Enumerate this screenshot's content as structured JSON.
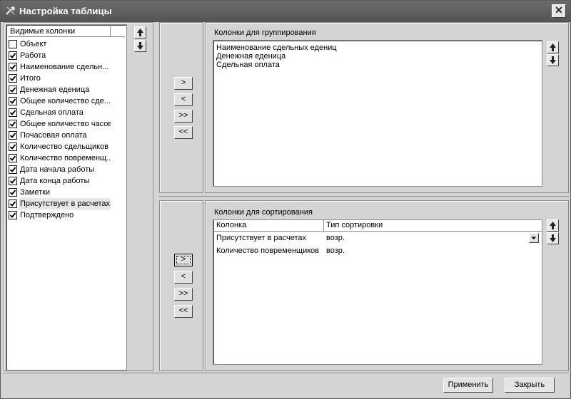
{
  "window": {
    "title": "Настройка таблицы",
    "close": "✕"
  },
  "visible_columns": {
    "header": "Видимые колонки",
    "items": [
      {
        "label": "Объект",
        "checked": false
      },
      {
        "label": "Работа",
        "checked": true
      },
      {
        "label": "Наименование сдельн...",
        "checked": true
      },
      {
        "label": "Итого",
        "checked": true
      },
      {
        "label": "Денежная еденица",
        "checked": true
      },
      {
        "label": "Общее количество сде...",
        "checked": true
      },
      {
        "label": "Сдельная оплата",
        "checked": true
      },
      {
        "label": "Общее количество часов",
        "checked": true
      },
      {
        "label": "Почасовая оплата",
        "checked": true
      },
      {
        "label": "Количество сдельщиков",
        "checked": true
      },
      {
        "label": "Количество повременщ...",
        "checked": true
      },
      {
        "label": "Дата начала работы",
        "checked": true
      },
      {
        "label": "Дата конца работы",
        "checked": true
      },
      {
        "label": "Заметки",
        "checked": true
      },
      {
        "label": "Присутствует в расчетах",
        "checked": true,
        "selected": true
      },
      {
        "label": "Подтверждено",
        "checked": true
      }
    ]
  },
  "transfer_buttons": {
    "add": ">",
    "remove": "<",
    "add_all": ">>",
    "remove_all": "<<"
  },
  "grouping": {
    "title": "Колонки для группирования",
    "items": [
      "Наименование сдельных едениц",
      "Денежная еденица",
      "Сдельная оплата"
    ]
  },
  "sorting": {
    "title": "Колонки для сортирования",
    "columns": [
      "Колонка",
      "Тип сортировки"
    ],
    "rows": [
      {
        "column": "Присутствует в расчетах",
        "order": "возр."
      },
      {
        "column": "Количество повременщиков",
        "order": "возр."
      }
    ]
  },
  "footer": {
    "apply": "Применить",
    "close": "Закрыть"
  }
}
